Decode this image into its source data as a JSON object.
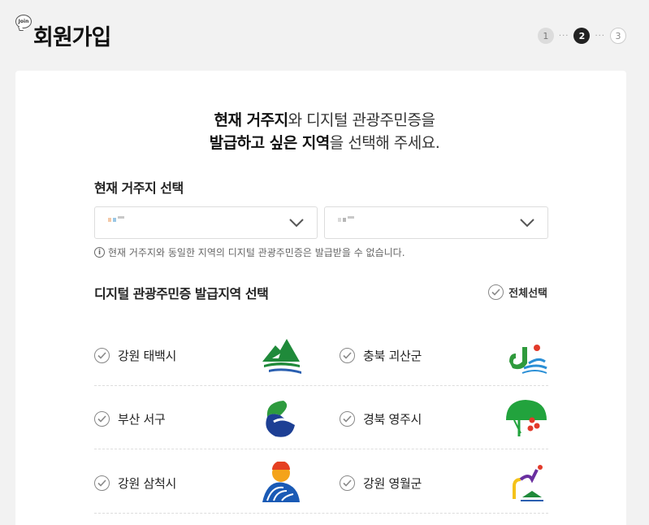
{
  "header": {
    "badge": "Join",
    "title": "회원가입",
    "steps": [
      {
        "label": "1",
        "state": "done"
      },
      {
        "label": "2",
        "state": "current"
      },
      {
        "label": "3",
        "state": "todo"
      }
    ],
    "step_separator": "···"
  },
  "headline": {
    "line1_bold": "현재 거주지",
    "line1_rest": "와 디지털 관광주민증을",
    "line2_bold": "발급하고 싶은 지역",
    "line2_rest": "을 선택해 주세요."
  },
  "residence": {
    "label": "현재 거주지 선택",
    "notice": "현재 거주지와 동일한 지역의 디지털 관광주민증은 발급받을 수 없습니다."
  },
  "issue": {
    "label": "디지털 관광주민증 발급지역 선택",
    "select_all": "전체선택",
    "regions": [
      {
        "name": "강원 태백시",
        "logo": "taebaek-logo"
      },
      {
        "name": "충북 괴산군",
        "logo": "goesan-logo"
      },
      {
        "name": "부산 서구",
        "logo": "busan-seogu-logo"
      },
      {
        "name": "경북 영주시",
        "logo": "yeongju-logo"
      },
      {
        "name": "강원 삼척시",
        "logo": "samcheok-logo"
      },
      {
        "name": "강원 영월군",
        "logo": "yeongwol-logo"
      }
    ]
  },
  "colors": {
    "check": "#888888",
    "accent_dark": "#222222"
  }
}
